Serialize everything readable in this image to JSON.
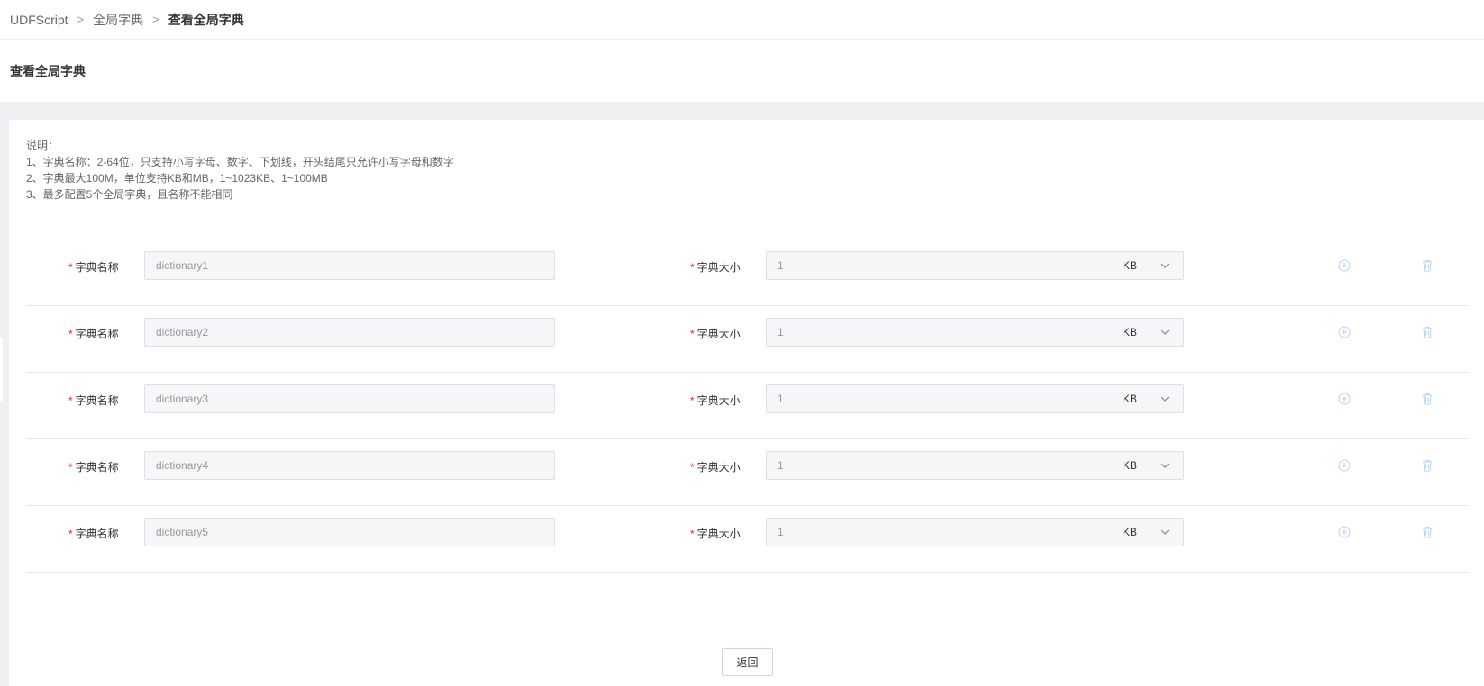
{
  "breadcrumb": {
    "items": [
      "UDFScript",
      "全局字典"
    ],
    "current": "查看全局字典",
    "separator": ">"
  },
  "page_title": "查看全局字典",
  "notes": [
    "说明：",
    "1、字典名称：2-64位，只支持小写字母、数字、下划线，开头结尾只允许小写字母和数字",
    "2、字典最大100M，单位支持KB和MB，1~1023KB、1~100MB",
    "3、最多配置5个全局字典，且名称不能相同"
  ],
  "form": {
    "required_mark": "*",
    "name_label": "字典名称",
    "size_label": "字典大小",
    "rows": [
      {
        "name": "dictionary1",
        "size": "1",
        "unit": "KB"
      },
      {
        "name": "dictionary2",
        "size": "1",
        "unit": "KB"
      },
      {
        "name": "dictionary3",
        "size": "1",
        "unit": "KB"
      },
      {
        "name": "dictionary4",
        "size": "1",
        "unit": "KB"
      },
      {
        "name": "dictionary5",
        "size": "1",
        "unit": "KB"
      }
    ],
    "icons": {
      "add": "plus-circle-icon",
      "delete": "trash-icon",
      "select": "chevron-down-icon"
    }
  },
  "back_button": "返回",
  "colors": {
    "required": "#f5222d",
    "icon_disabled": "#b9d3f2",
    "page_bg": "#eef0f3"
  }
}
